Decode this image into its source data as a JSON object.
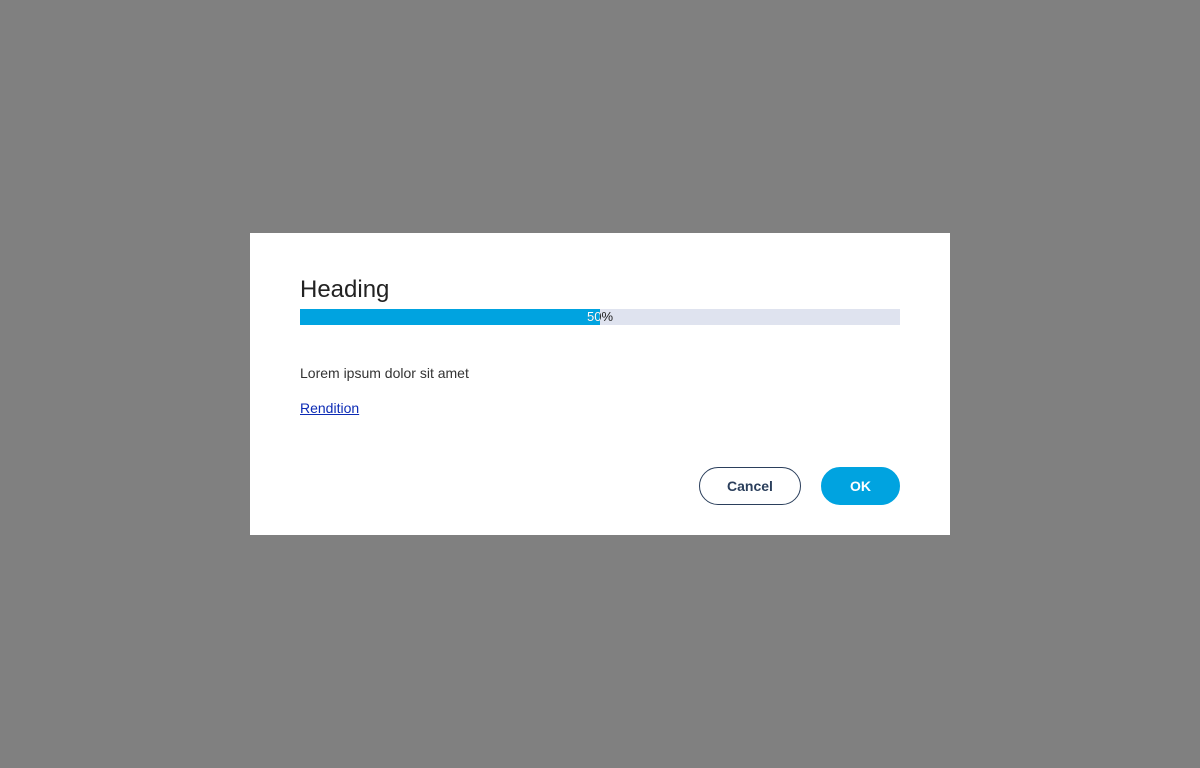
{
  "dialog": {
    "heading": "Heading",
    "progress": {
      "value": 0.5,
      "label": "50%",
      "fill_color": "#00a3e0",
      "track_color": "#dfe3ef"
    },
    "message": "Lorem ipsum dolor sit amet",
    "link_label": "Rendition",
    "buttons": {
      "cancel_label": "Cancel",
      "ok_label": "OK"
    }
  },
  "colors": {
    "overlay": "#808080",
    "accent": "#00a3e0",
    "link": "#0c2bb5",
    "cancel_border": "#2b3f5c"
  }
}
